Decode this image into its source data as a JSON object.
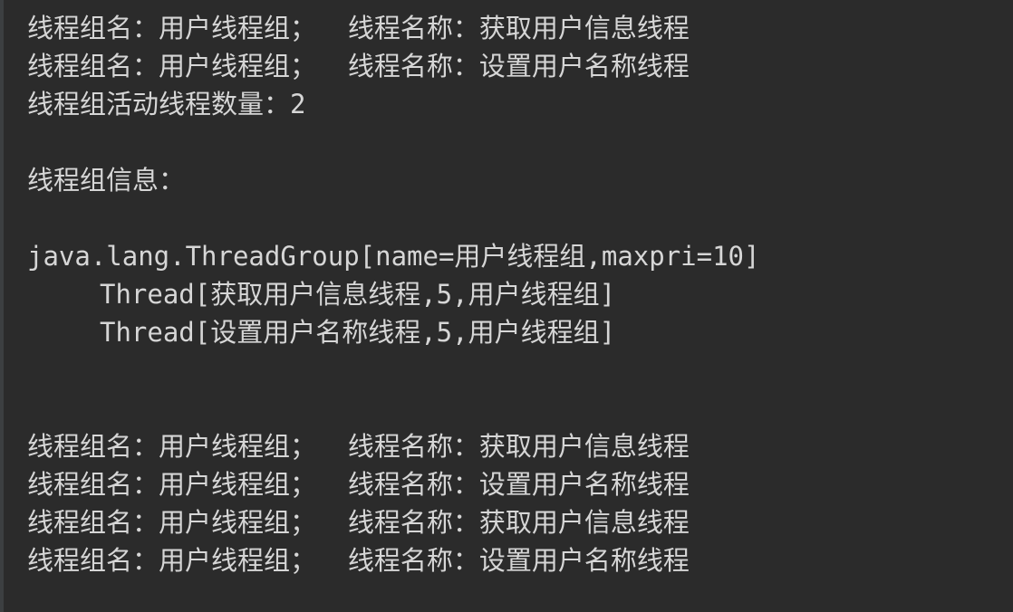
{
  "console": {
    "clipped_top_text": "",
    "lines": [
      "线程组名：用户线程组；  线程名称：获取用户信息线程",
      "线程组名：用户线程组；  线程名称：设置用户名称线程",
      "线程组活动线程数量：2",
      "",
      "线程组信息：",
      "",
      "java.lang.ThreadGroup[name=用户线程组,maxpri=10]",
      "Thread[获取用户信息线程,5,用户线程组]",
      "Thread[设置用户名称线程,5,用户线程组]",
      "",
      "",
      "线程组名：用户线程组；  线程名称：获取用户信息线程",
      "线程组名：用户线程组；  线程名称：设置用户名称线程",
      "线程组名：用户线程组；  线程名称：获取用户信息线程",
      "线程组名：用户线程组；  线程名称：设置用户名称线程"
    ]
  },
  "colors": {
    "background": "#2b2b2b",
    "text": "#d6d6d6",
    "clipped_text": "#e06c6c"
  }
}
